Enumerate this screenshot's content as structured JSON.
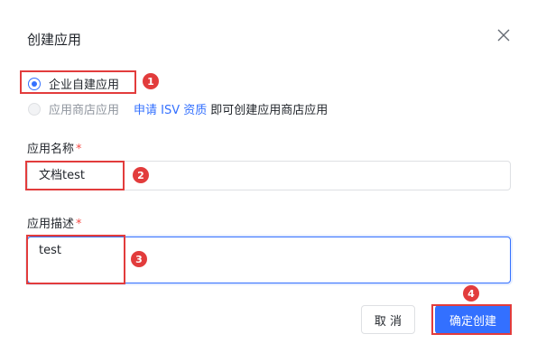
{
  "dialog": {
    "title": "创建应用",
    "close_icon": "close-icon"
  },
  "app_type": {
    "options": [
      {
        "label": "企业自建应用",
        "checked": true,
        "disabled": false
      },
      {
        "label": "应用商店应用",
        "checked": false,
        "disabled": true
      }
    ],
    "apply_link": "申请 ISV 资质",
    "apply_suffix": "即可创建应用商店应用"
  },
  "form": {
    "name_label": "应用名称",
    "name_value": "文档test",
    "desc_label": "应用描述",
    "desc_value": "test",
    "required_mark": "*"
  },
  "footer": {
    "cancel_label": "取 消",
    "ok_label": "确定创建"
  },
  "annotations": [
    "1",
    "2",
    "3",
    "4"
  ],
  "colors": {
    "primary": "#3370ff",
    "annotation": "#e23c3c",
    "required": "#f54a45"
  }
}
